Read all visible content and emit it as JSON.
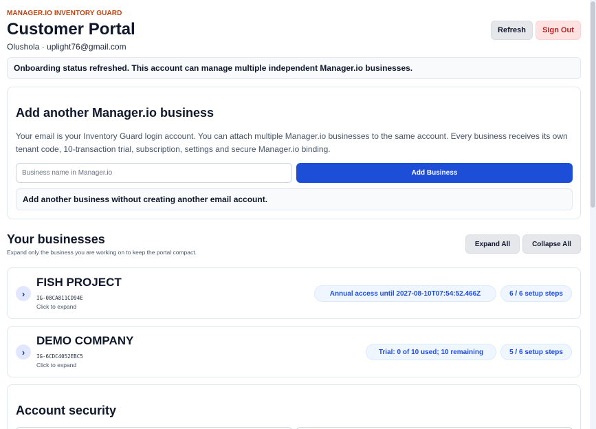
{
  "header": {
    "brand": "MANAGER.IO INVENTORY GUARD",
    "title": "Customer Portal",
    "user": "Olushola · uplight76@gmail.com",
    "refresh_label": "Refresh",
    "signout_label": "Sign Out"
  },
  "status_banner": "Onboarding status refreshed. This account can manage multiple independent Manager.io businesses.",
  "add_business": {
    "title": "Add another Manager.io business",
    "description": "Your email is your Inventory Guard login account. You can attach multiple Manager.io businesses to the same account. Every business receives its own tenant code, 10-transaction trial, subscription, settings and secure Manager.io binding.",
    "input_placeholder": "Business name in Manager.io",
    "input_value": "",
    "button_label": "Add Business",
    "note": "Add another business without creating another email account."
  },
  "businesses": {
    "title": "Your businesses",
    "subtitle": "Expand only the business you are working on to keep the portal compact.",
    "expand_all_label": "Expand All",
    "collapse_all_label": "Collapse All",
    "items": [
      {
        "name": "FISH PROJECT",
        "code": "IG-08CA811CD94E",
        "hint": "Click to expand",
        "access": "Annual access until 2027-08-10T07:54:52.466Z",
        "setup": "6 / 6 setup steps"
      },
      {
        "name": "DEMO COMPANY",
        "code": "IG-6CDC4052EBC5",
        "hint": "Click to expand",
        "access": "Trial: 0 of 10 used; 10 remaining",
        "setup": "5 / 6 setup steps"
      }
    ]
  },
  "security": {
    "title": "Account security"
  },
  "icons": {
    "chevron": "chevron-right-icon"
  },
  "colors": {
    "brand": "#c2410c",
    "primary": "#1d4ed8",
    "danger_text": "#b91c1c",
    "danger_bg": "#fee2e2",
    "pill_bg": "#eff6ff"
  }
}
